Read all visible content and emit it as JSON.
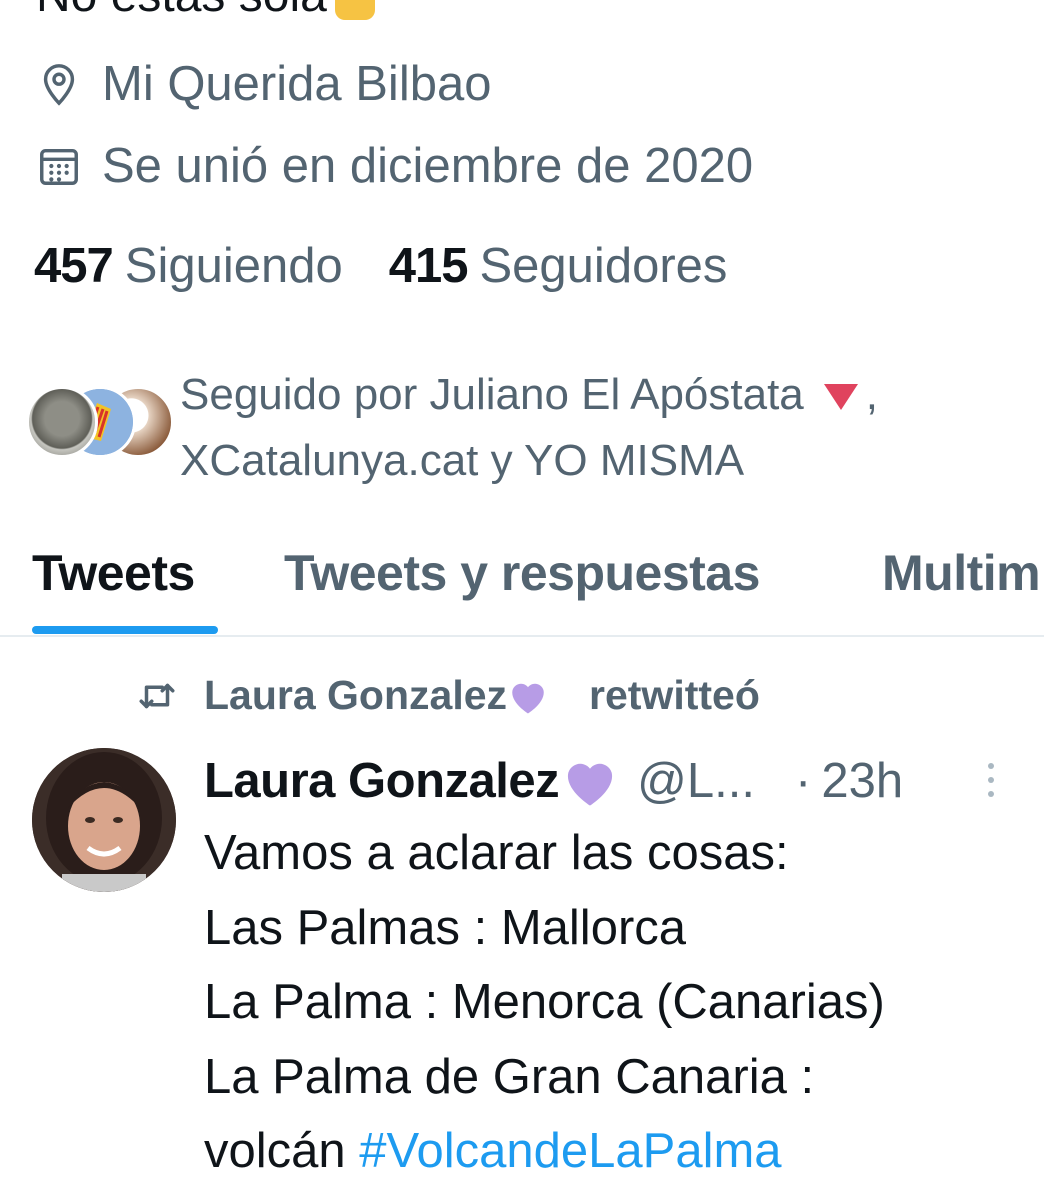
{
  "profile": {
    "bio_partial": "No estás sola",
    "location": "Mi Querida Bilbao",
    "joined": "Se unió en diciembre de 2020",
    "following_count": "457",
    "following_label": "Siguiendo",
    "followers_count": "415",
    "followers_label": "Seguidores",
    "followed_by_line1": "Seguido por Juliano El Apóstata",
    "followed_by_comma": ",",
    "followed_by_line2": "XCatalunya.cat y YO MISMA"
  },
  "tabs": [
    {
      "label": "Tweets",
      "active": true
    },
    {
      "label": "Tweets y respuestas",
      "active": false
    },
    {
      "label": "Multim",
      "active": false
    }
  ],
  "tweet": {
    "retweeter": "Laura Gonzalez",
    "retweeted_label": "retwitteó",
    "author": "Laura Gonzalez",
    "handle": "@L...",
    "separator": "·",
    "time": "23h",
    "lines": [
      "Vamos a aclarar las cosas:",
      "Las Palmas : Mallorca",
      "La Palma : Menorca (Canarias)",
      "La Palma de Gran Canaria :",
      "volcán"
    ],
    "hashtag": "#VolcandeLaPalma"
  },
  "colors": {
    "accent": "#1d9bf0",
    "text": "#0f1419",
    "secondary": "#536471",
    "heart": "#b79ce6",
    "flag_triangle": "#e0435e"
  }
}
